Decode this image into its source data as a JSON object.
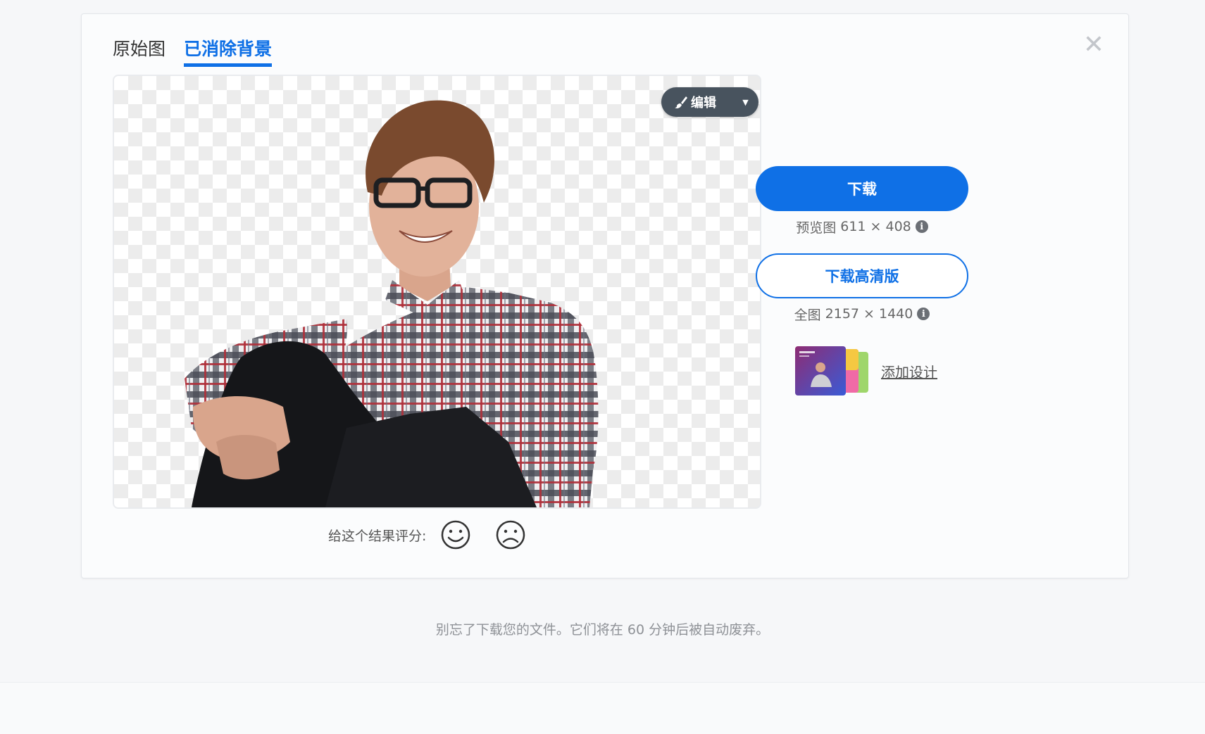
{
  "tabs": [
    {
      "label": "原始图",
      "active": false
    },
    {
      "label": "已消除背景",
      "active": true
    }
  ],
  "close": {
    "glyph": "✕"
  },
  "edit": {
    "label": "编辑",
    "icon": "brush-icon",
    "caret": "▼"
  },
  "rating": {
    "label": "给这个结果评分:",
    "icons": [
      "happy-face-icon",
      "sad-face-icon"
    ]
  },
  "download": {
    "label": "下载",
    "preview_label": "预览图",
    "preview_size": "611 × 408",
    "hd_label": "下载高清版",
    "full_label": "全图",
    "full_size": "2157 × 1440",
    "info_glyph": "i"
  },
  "design": {
    "label": "添加设计"
  },
  "footer": {
    "note": "别忘了下载您的文件。它们将在 60 分钟后被自动废弃。"
  },
  "colors": {
    "accent": "#0f70e6",
    "edit_button": "#48535e",
    "background": "#f6f7f9"
  }
}
